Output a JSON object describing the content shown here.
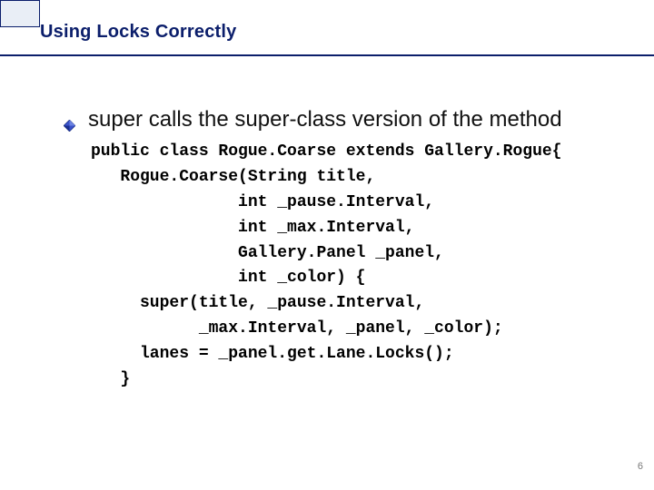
{
  "slide": {
    "title": "Using Locks Correctly",
    "bullet": "super calls the super-class version of the method",
    "code": "public class Rogue.Coarse extends Gallery.Rogue{\n   Rogue.Coarse(String title,\n               int _pause.Interval,\n               int _max.Interval,\n               Gallery.Panel _panel,\n               int _color) {\n     super(title, _pause.Interval,\n           _max.Interval, _panel, _color);\n     lanes = _panel.get.Lane.Locks();\n   }",
    "page_number": "6"
  },
  "colors": {
    "accent": "#0b1e6b",
    "corner_fill": "#e9eef6"
  }
}
